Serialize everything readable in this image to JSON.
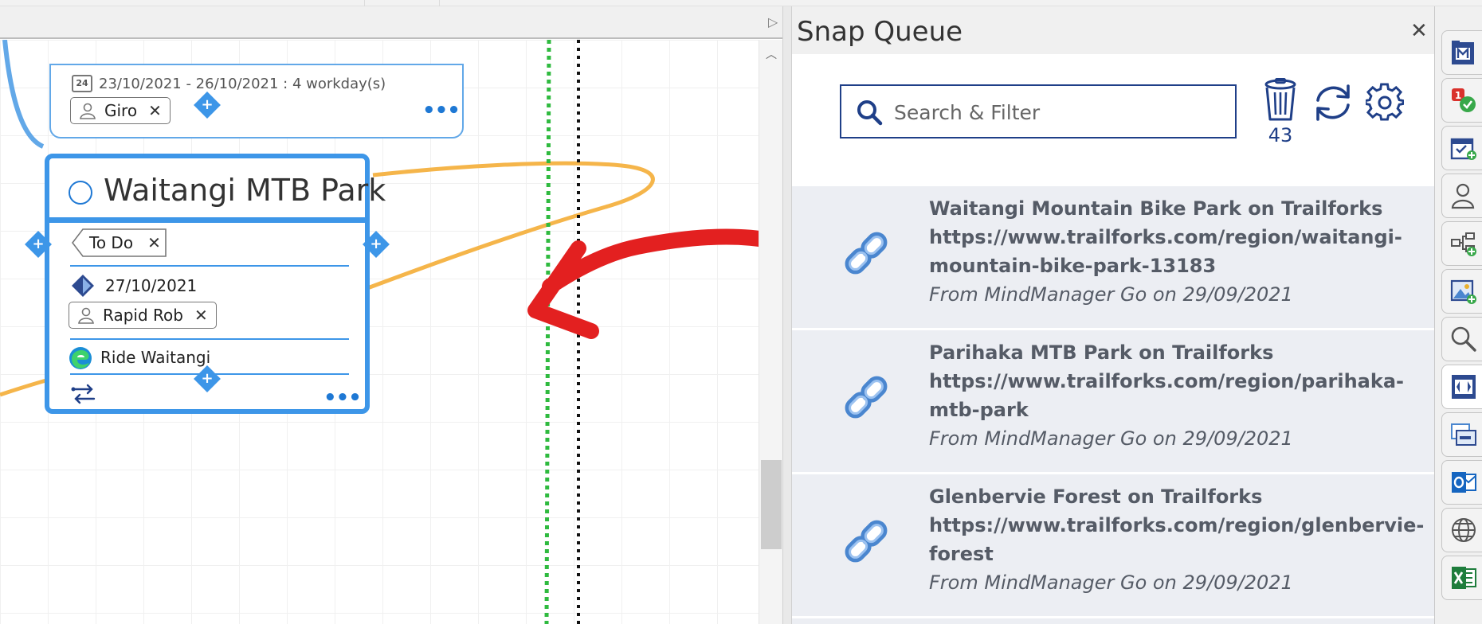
{
  "canvas": {
    "upper_topic": {
      "date_icon_text": "24",
      "date_range": "23/10/2021 - 26/10/2021 : 4 workday(s)",
      "resource": "Giro",
      "chip_close": "✕",
      "more": "•••"
    },
    "topic": {
      "title": "Waitangi MTB Park",
      "tag": "To Do",
      "tag_close": "✕",
      "due_date": "27/10/2021",
      "resource": "Rapid Rob",
      "resource_close": "✕",
      "link_text": "Ride Waitangi",
      "more": "•••",
      "handle_plus": "+"
    },
    "collapse_glyph": "▷",
    "scroll_up_glyph": "︿"
  },
  "panel": {
    "title": "Snap Queue",
    "close": "✕",
    "search_placeholder": "Search & Filter",
    "search_value": "",
    "trash_count": "43",
    "items": [
      {
        "title": "Waitangi Mountain Bike Park on Trailforks",
        "url_line1": "https://www.trailforks.com/region/waitangi-",
        "url_line2": "mountain-bike-park-13183",
        "source": "From MindManager Go on 29/09/2021"
      },
      {
        "title": "Parihaka MTB Park on Trailforks",
        "url_line1": "https://www.trailforks.com/region/parihaka-",
        "url_line2": "mtb-park",
        "source": "From MindManager Go on 29/09/2021"
      },
      {
        "title": "Glenbervie Forest on Trailforks",
        "url_line1": "https://www.trailforks.com/region/glenbervie-",
        "url_line2": "forest",
        "source": "From MindManager Go on 29/09/2021"
      }
    ]
  },
  "dock": {
    "buttons": [
      "map-index-icon",
      "priority-check-icon",
      "calendar-add-icon",
      "person-icon",
      "flow-add-icon",
      "image-add-icon",
      "search-icon",
      "snap-queue-icon",
      "window-icon",
      "outlook-icon",
      "globe-icon",
      "excel-icon"
    ]
  },
  "colors": {
    "topic_border": "#3d96e8",
    "arrow": "#e32020",
    "relationship_line": "#f5b54a",
    "accent_navy": "#1f3f88",
    "green_dotted": "#2fba3f"
  }
}
